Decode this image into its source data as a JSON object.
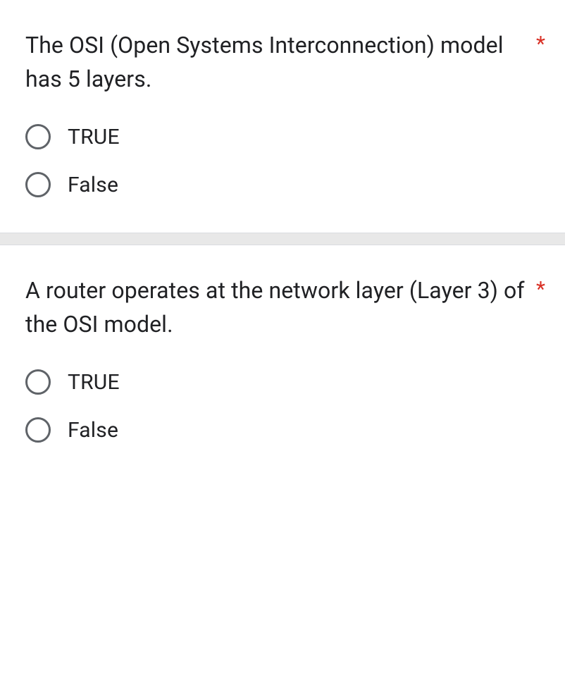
{
  "questions": [
    {
      "text": "The OSI (Open Systems Interconnection) model has 5 layers.",
      "required_mark": "*",
      "options": [
        {
          "label": "TRUE"
        },
        {
          "label": "False"
        }
      ]
    },
    {
      "text": "A router operates at the network layer (Layer 3) of the OSI model.",
      "required_mark": "*",
      "options": [
        {
          "label": "TRUE"
        },
        {
          "label": "False"
        }
      ]
    }
  ]
}
